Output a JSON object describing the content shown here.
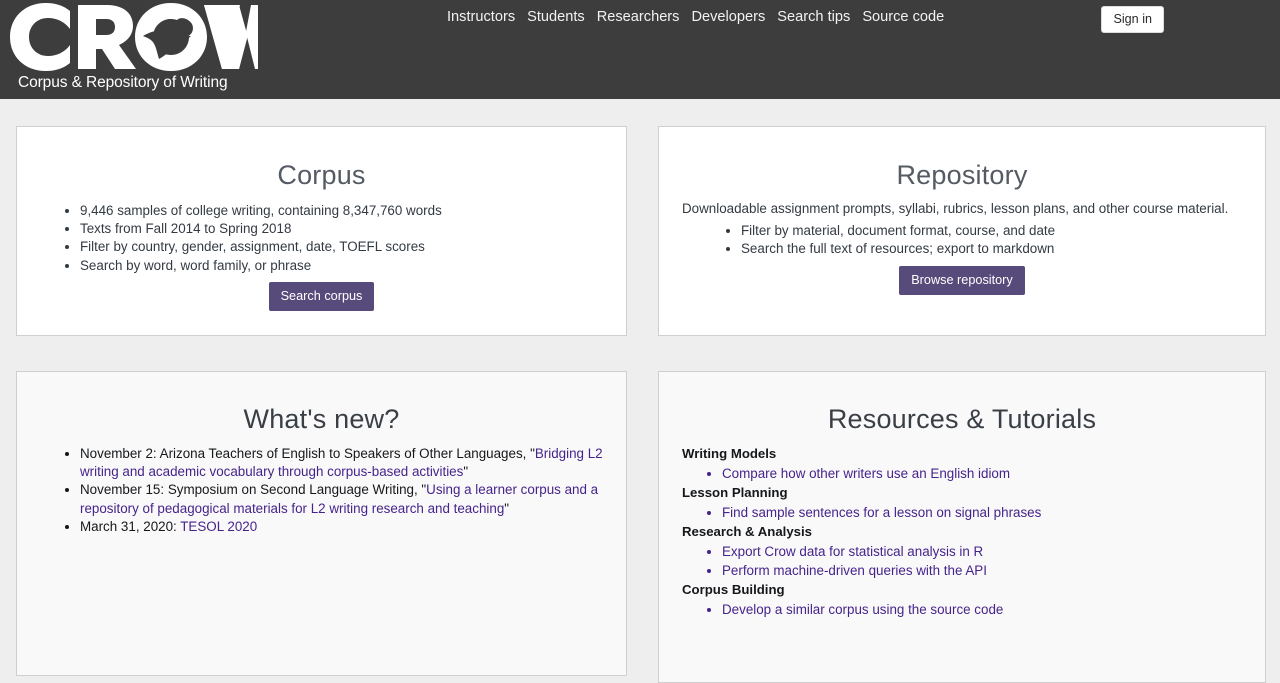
{
  "header": {
    "logo_text": "CROW",
    "logo_icon": "crow-bird-icon",
    "tagline": "Corpus & Repository of Writing",
    "nav_items": [
      {
        "label": "Instructors"
      },
      {
        "label": "Students"
      },
      {
        "label": "Researchers"
      },
      {
        "label": "Developers"
      },
      {
        "label": "Search tips"
      },
      {
        "label": "Source code"
      }
    ],
    "signin_label": "Sign in",
    "background_color": "#3d3d3d"
  },
  "colors": {
    "page_background": "#eeeeee",
    "accent_button": "#574b7c",
    "link": "#46238c",
    "card_border": "#cfcfcf"
  },
  "cards": {
    "corpus": {
      "title": "Corpus",
      "bullets": [
        "9,446 samples of college writing, containing 8,347,760 words",
        "Texts from Fall 2014 to Spring 2018",
        "Filter by country, gender, assignment, date, TOEFL scores",
        "Search by word, word family, or phrase"
      ],
      "button_label": "Search corpus"
    },
    "repository": {
      "title": "Repository",
      "lead": "Downloadable assignment prompts, syllabi, rubrics, lesson plans, and other course material.",
      "bullets": [
        "Filter by material, document format, course, and date",
        "Search the full text of resources; export to markdown"
      ],
      "button_label": "Browse repository"
    },
    "whats_new": {
      "title": "What's new?",
      "items": [
        {
          "prefix": "November 2: Arizona Teachers of English to Speakers of Other Languages, \"",
          "link": "Bridging L2 writing and academic vocabulary through corpus-based activities",
          "suffix": "\""
        },
        {
          "prefix": "November 15: Symposium on Second Language Writing, \"",
          "link": "Using a learner corpus and a repository of pedagogical materials for L2 writing research and teaching",
          "suffix": "\""
        },
        {
          "prefix": "March 31, 2020: ",
          "link": "TESOL 2020",
          "suffix": ""
        }
      ]
    },
    "resources": {
      "title": "Resources & Tutorials",
      "groups": [
        {
          "heading": "Writing Models",
          "links": [
            "Compare how other writers use an English idiom"
          ]
        },
        {
          "heading": "Lesson Planning",
          "links": [
            "Find sample sentences for a lesson on signal phrases"
          ]
        },
        {
          "heading": "Research & Analysis",
          "links": [
            "Export Crow data for statistical analysis in R",
            "Perform machine-driven queries with the API"
          ]
        },
        {
          "heading": "Corpus Building",
          "links": [
            "Develop a similar corpus using the source code"
          ]
        }
      ]
    }
  }
}
